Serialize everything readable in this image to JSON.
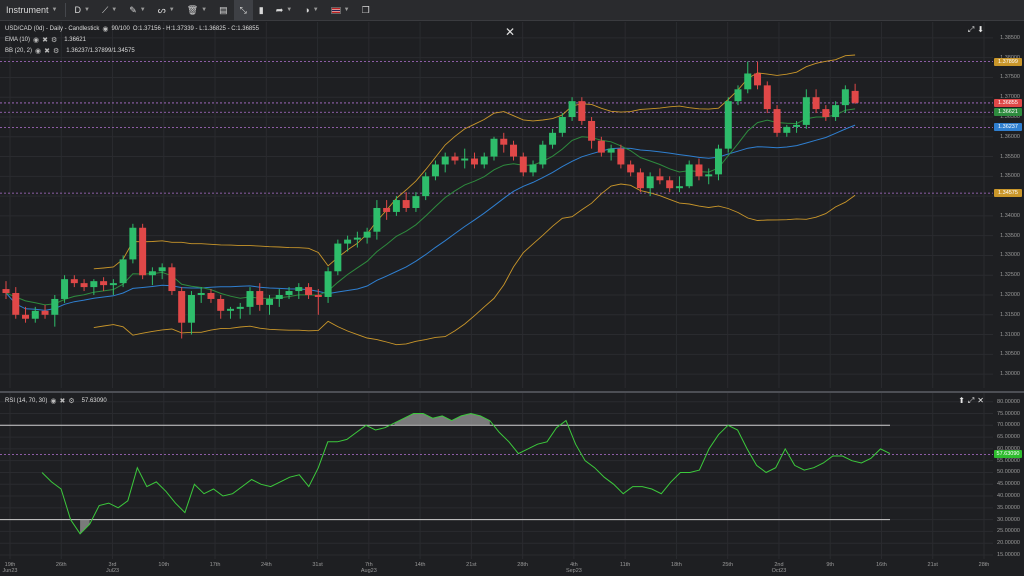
{
  "toolbar": {
    "instrument_label": "Instrument",
    "timeframe_label": "D",
    "accent_color": "#3e4045"
  },
  "legend": {
    "title": "USD/CAD (0d) - Daily - Candlestick",
    "progress": "90/100",
    "ohlc": "O:1.37156 - H:1.37339 - L:1.36825 - C:1.36855",
    "ema_label": "EMA (10)",
    "ema_value": "1.36621",
    "bb_label": "BB (20, 2)",
    "bb_value": "1.36237/1.37899/1.34575",
    "rsi_label": "RSI (14, 70, 30)",
    "rsi_value": "57.63090"
  },
  "price_axis": {
    "labels": [
      "1.38500",
      "1.38000",
      "1.37500",
      "1.37000",
      "1.36500",
      "1.36000",
      "1.35500",
      "1.35000",
      "1.34500",
      "1.34000",
      "1.33500",
      "1.33000",
      "1.32500",
      "1.32000",
      "1.31500",
      "1.31000",
      "1.30500",
      "1.30000"
    ],
    "tags": {
      "bb_upper": "1.37899",
      "close": "1.36855",
      "ema": "1.36621",
      "bb_mid": "1.36237",
      "bb_lower": "1.34575"
    }
  },
  "rsi_axis": {
    "labels": [
      "80.00000",
      "75.00000",
      "70.00000",
      "65.00000",
      "60.00000",
      "55.00000",
      "50.00000",
      "45.00000",
      "40.00000",
      "35.00000",
      "30.00000",
      "25.00000",
      "20.00000",
      "15.00000"
    ],
    "tag": "57.63090"
  },
  "date_axis": [
    {
      "line1": "19th",
      "line2": "Jun23"
    },
    {
      "line1": "26th",
      "line2": ""
    },
    {
      "line1": "3rd",
      "line2": "Jul23"
    },
    {
      "line1": "10th",
      "line2": ""
    },
    {
      "line1": "17th",
      "line2": ""
    },
    {
      "line1": "24th",
      "line2": ""
    },
    {
      "line1": "31st",
      "line2": ""
    },
    {
      "line1": "7th",
      "line2": "Aug23"
    },
    {
      "line1": "14th",
      "line2": ""
    },
    {
      "line1": "21st",
      "line2": ""
    },
    {
      "line1": "28th",
      "line2": ""
    },
    {
      "line1": "4th",
      "line2": "Sep23"
    },
    {
      "line1": "11th",
      "line2": ""
    },
    {
      "line1": "18th",
      "line2": ""
    },
    {
      "line1": "25th",
      "line2": ""
    },
    {
      "line1": "2nd",
      "line2": "Oct23"
    },
    {
      "line1": "9th",
      "line2": ""
    },
    {
      "line1": "16th",
      "line2": ""
    },
    {
      "line1": "21st",
      "line2": ""
    },
    {
      "line1": "28th",
      "line2": ""
    }
  ],
  "chart_data": {
    "type": "candlestick",
    "colors": {
      "up": "#2ebd6b",
      "down": "#e04848",
      "ema": "#2e8b3e",
      "bb_mid": "#2f7fd0",
      "bb_band": "#c9962a",
      "rsi": "#3cc93c"
    },
    "y_range": [
      1.2975,
      1.3875
    ],
    "levels": [
      1.37899,
      1.36855,
      1.36621,
      1.36237,
      1.34575
    ],
    "candles": [
      [
        1.3215,
        1.3235,
        1.319,
        1.3205
      ],
      [
        1.3205,
        1.322,
        1.314,
        1.315
      ],
      [
        1.315,
        1.317,
        1.313,
        1.314
      ],
      [
        1.314,
        1.317,
        1.313,
        1.316
      ],
      [
        1.316,
        1.3175,
        1.314,
        1.315
      ],
      [
        1.315,
        1.32,
        1.312,
        1.319
      ],
      [
        1.319,
        1.325,
        1.318,
        1.324
      ],
      [
        1.324,
        1.325,
        1.322,
        1.323
      ],
      [
        1.323,
        1.324,
        1.321,
        1.322
      ],
      [
        1.322,
        1.324,
        1.32,
        1.3235
      ],
      [
        1.3235,
        1.3245,
        1.321,
        1.3225
      ],
      [
        1.3225,
        1.324,
        1.32,
        1.323
      ],
      [
        1.323,
        1.33,
        1.322,
        1.329
      ],
      [
        1.329,
        1.338,
        1.328,
        1.337
      ],
      [
        1.337,
        1.338,
        1.324,
        1.325
      ],
      [
        1.325,
        1.327,
        1.3225,
        1.326
      ],
      [
        1.326,
        1.328,
        1.324,
        1.327
      ],
      [
        1.327,
        1.328,
        1.32,
        1.321
      ],
      [
        1.321,
        1.322,
        1.309,
        1.313
      ],
      [
        1.313,
        1.321,
        1.31,
        1.32
      ],
      [
        1.32,
        1.322,
        1.318,
        1.3205
      ],
      [
        1.3205,
        1.3215,
        1.318,
        1.319
      ],
      [
        1.319,
        1.32,
        1.314,
        1.316
      ],
      [
        1.316,
        1.317,
        1.314,
        1.3165
      ],
      [
        1.3165,
        1.318,
        1.314,
        1.317
      ],
      [
        1.317,
        1.322,
        1.315,
        1.321
      ],
      [
        1.321,
        1.323,
        1.316,
        1.3175
      ],
      [
        1.3175,
        1.32,
        1.315,
        1.319
      ],
      [
        1.319,
        1.3215,
        1.317,
        1.32
      ],
      [
        1.32,
        1.322,
        1.319,
        1.321
      ],
      [
        1.321,
        1.323,
        1.319,
        1.322
      ],
      [
        1.322,
        1.323,
        1.319,
        1.32
      ],
      [
        1.32,
        1.3215,
        1.315,
        1.3195
      ],
      [
        1.3195,
        1.327,
        1.318,
        1.326
      ],
      [
        1.326,
        1.334,
        1.325,
        1.333
      ],
      [
        1.333,
        1.335,
        1.331,
        1.334
      ],
      [
        1.334,
        1.336,
        1.332,
        1.3345
      ],
      [
        1.3345,
        1.337,
        1.333,
        1.336
      ],
      [
        1.336,
        1.344,
        1.334,
        1.342
      ],
      [
        1.342,
        1.344,
        1.339,
        1.341
      ],
      [
        1.341,
        1.345,
        1.34,
        1.344
      ],
      [
        1.344,
        1.346,
        1.341,
        1.342
      ],
      [
        1.342,
        1.346,
        1.341,
        1.345
      ],
      [
        1.345,
        1.351,
        1.344,
        1.35
      ],
      [
        1.35,
        1.354,
        1.349,
        1.353
      ],
      [
        1.353,
        1.356,
        1.351,
        1.355
      ],
      [
        1.355,
        1.356,
        1.353,
        1.354
      ],
      [
        1.354,
        1.357,
        1.352,
        1.3545
      ],
      [
        1.3545,
        1.356,
        1.352,
        1.353
      ],
      [
        1.353,
        1.356,
        1.352,
        1.355
      ],
      [
        1.355,
        1.36,
        1.354,
        1.3595
      ],
      [
        1.3595,
        1.361,
        1.356,
        1.358
      ],
      [
        1.358,
        1.359,
        1.354,
        1.355
      ],
      [
        1.355,
        1.356,
        1.35,
        1.351
      ],
      [
        1.351,
        1.354,
        1.35,
        1.353
      ],
      [
        1.353,
        1.359,
        1.352,
        1.358
      ],
      [
        1.358,
        1.362,
        1.357,
        1.361
      ],
      [
        1.361,
        1.366,
        1.36,
        1.365
      ],
      [
        1.365,
        1.37,
        1.364,
        1.369
      ],
      [
        1.369,
        1.37,
        1.363,
        1.364
      ],
      [
        1.364,
        1.365,
        1.357,
        1.359
      ],
      [
        1.359,
        1.36,
        1.355,
        1.356
      ],
      [
        1.356,
        1.358,
        1.354,
        1.357
      ],
      [
        1.357,
        1.358,
        1.352,
        1.353
      ],
      [
        1.353,
        1.354,
        1.35,
        1.351
      ],
      [
        1.351,
        1.352,
        1.346,
        1.347
      ],
      [
        1.347,
        1.351,
        1.345,
        1.35
      ],
      [
        1.35,
        1.352,
        1.348,
        1.349
      ],
      [
        1.349,
        1.35,
        1.346,
        1.347
      ],
      [
        1.347,
        1.35,
        1.346,
        1.3475
      ],
      [
        1.3475,
        1.354,
        1.347,
        1.353
      ],
      [
        1.353,
        1.3545,
        1.349,
        1.35
      ],
      [
        1.35,
        1.352,
        1.348,
        1.3505
      ],
      [
        1.3505,
        1.358,
        1.349,
        1.357
      ],
      [
        1.357,
        1.37,
        1.356,
        1.369
      ],
      [
        1.369,
        1.373,
        1.368,
        1.372
      ],
      [
        1.372,
        1.379,
        1.371,
        1.376
      ],
      [
        1.376,
        1.379,
        1.372,
        1.373
      ],
      [
        1.373,
        1.374,
        1.366,
        1.367
      ],
      [
        1.367,
        1.368,
        1.36,
        1.361
      ],
      [
        1.361,
        1.363,
        1.36,
        1.3625
      ],
      [
        1.3625,
        1.364,
        1.361,
        1.363
      ],
      [
        1.363,
        1.372,
        1.362,
        1.37
      ],
      [
        1.37,
        1.372,
        1.366,
        1.367
      ],
      [
        1.367,
        1.368,
        1.364,
        1.365
      ],
      [
        1.365,
        1.369,
        1.364,
        1.368
      ],
      [
        1.368,
        1.373,
        1.366,
        1.372
      ],
      [
        1.3716,
        1.3734,
        1.3683,
        1.3686
      ]
    ],
    "rsi_range": [
      15,
      82
    ],
    "rsi_levels": [
      70,
      30
    ],
    "rsi": [
      50,
      46,
      43,
      30,
      24,
      28,
      36,
      37,
      35,
      38,
      52,
      44,
      46,
      42,
      37,
      33,
      45,
      41,
      43,
      40,
      41,
      44,
      47,
      45,
      44,
      46,
      48,
      49,
      44,
      52,
      63,
      63,
      64,
      67,
      70,
      68,
      69,
      71,
      73,
      75,
      75,
      73,
      74,
      72,
      74,
      75,
      74,
      72,
      67,
      63,
      58,
      60,
      62,
      63,
      69,
      72,
      62,
      55,
      52,
      48,
      45,
      41,
      44,
      44,
      43,
      41,
      46,
      50,
      50,
      51,
      60,
      66,
      70,
      68,
      60,
      53,
      50,
      52,
      60,
      53,
      51,
      52,
      54,
      57,
      57,
      55,
      54,
      56,
      60,
      58
    ]
  }
}
